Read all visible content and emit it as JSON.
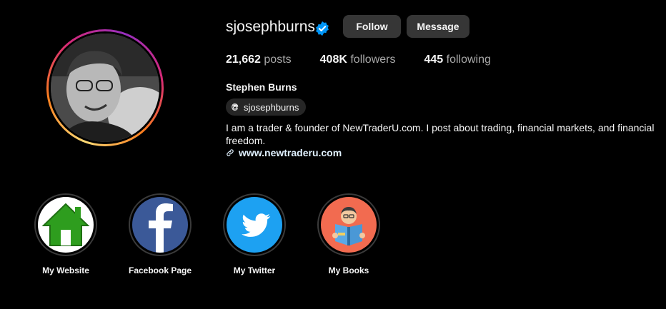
{
  "profile": {
    "username": "sjosephburns",
    "full_name": "Stephen Burns",
    "follow_label": "Follow",
    "message_label": "Message",
    "threads_handle": "sjosephburns",
    "bio": "I am a trader & founder of NewTraderU.com. I post about trading, financial markets, and financial freedom.",
    "website": "www.newtraderu.com"
  },
  "stats": [
    {
      "value": "21,662",
      "label": "posts"
    },
    {
      "value": "408K",
      "label": "followers"
    },
    {
      "value": "445",
      "label": "following"
    }
  ],
  "highlights": [
    {
      "label": "My Website",
      "icon": "house-icon"
    },
    {
      "label": "Facebook Page",
      "icon": "facebook-icon"
    },
    {
      "label": "My Twitter",
      "icon": "twitter-bird-icon"
    },
    {
      "label": "My Books",
      "icon": "reader-book-icon"
    }
  ],
  "colors": {
    "verified": "#0095f6",
    "button_bg": "#363636",
    "pill_bg": "#262626",
    "facebook": "#3b5998",
    "twitter": "#1da1f2",
    "books_bg": "#f26b50"
  }
}
